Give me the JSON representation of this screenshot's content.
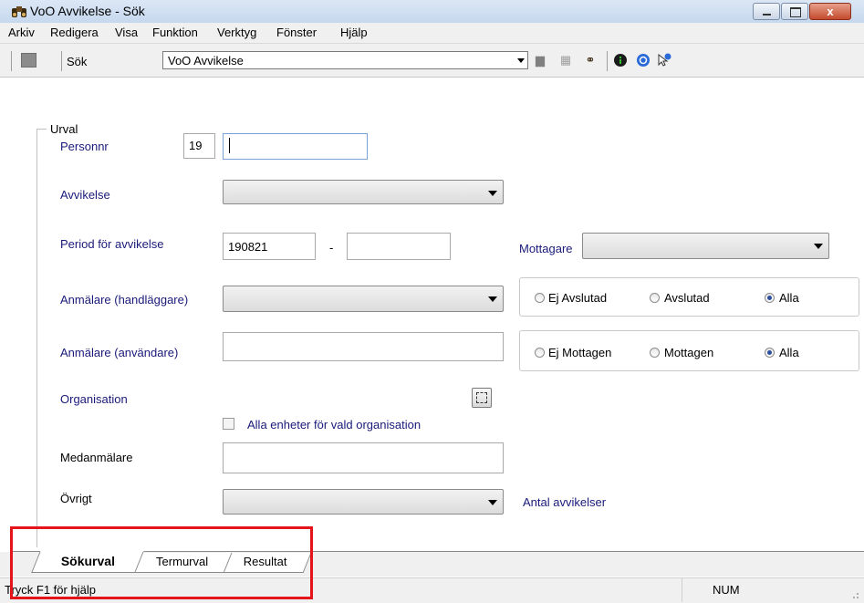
{
  "window": {
    "title": "VoO Avvikelse - Sök",
    "close_label": "x"
  },
  "menu": [
    "Arkiv",
    "Redigera",
    "Visa",
    "Funktion",
    "Verktyg",
    "Fönster",
    "Hjälp"
  ],
  "toolbar": {
    "search_label": "Sök",
    "combo_value": "VoO Avvikelse",
    "icons": [
      "save-icon",
      "print-icon",
      "print-preview-icon",
      "binoculars-icon",
      "info-icon",
      "help-icon",
      "context-help-icon"
    ]
  },
  "form": {
    "group_label": "Urval",
    "personnr": {
      "label": "Personnr",
      "century": "19",
      "value": ""
    },
    "avvikelse": {
      "label": "Avvikelse",
      "value": ""
    },
    "period": {
      "label": "Period för avvikelse",
      "from": "190821",
      "separator": "-",
      "to": ""
    },
    "mottagare": {
      "label": "Mottagare",
      "value": ""
    },
    "anmalare_handlaggare": {
      "label": "Anmälare (handläggare)",
      "value": ""
    },
    "status_radios": [
      {
        "label": "Ej Avslutad",
        "checked": false
      },
      {
        "label": "Avslutad",
        "checked": false
      },
      {
        "label": "Alla",
        "checked": true
      }
    ],
    "anmalare_anvandare": {
      "label": "Anmälare (användare)",
      "value": ""
    },
    "mottagen_radios": [
      {
        "label": "Ej Mottagen",
        "checked": false
      },
      {
        "label": "Mottagen",
        "checked": false
      },
      {
        "label": "Alla",
        "checked": true
      }
    ],
    "organisation": {
      "label": "Organisation",
      "checkbox_label": "Alla enheter för vald organisation"
    },
    "medanmalare": {
      "label": "Medanmälare",
      "value": ""
    },
    "ovrigt": {
      "label": "Övrigt",
      "value": ""
    },
    "antal_label": "Antal avvikelser"
  },
  "tabs": [
    "Sökurval",
    "Termurval",
    "Resultat"
  ],
  "status": {
    "help_text": "Tryck F1 för hjälp",
    "num": "NUM"
  },
  "colors": {
    "highlight": "#e3151a",
    "label_blue": "#1a1a7a",
    "titlebar": "#c6d8ee"
  }
}
